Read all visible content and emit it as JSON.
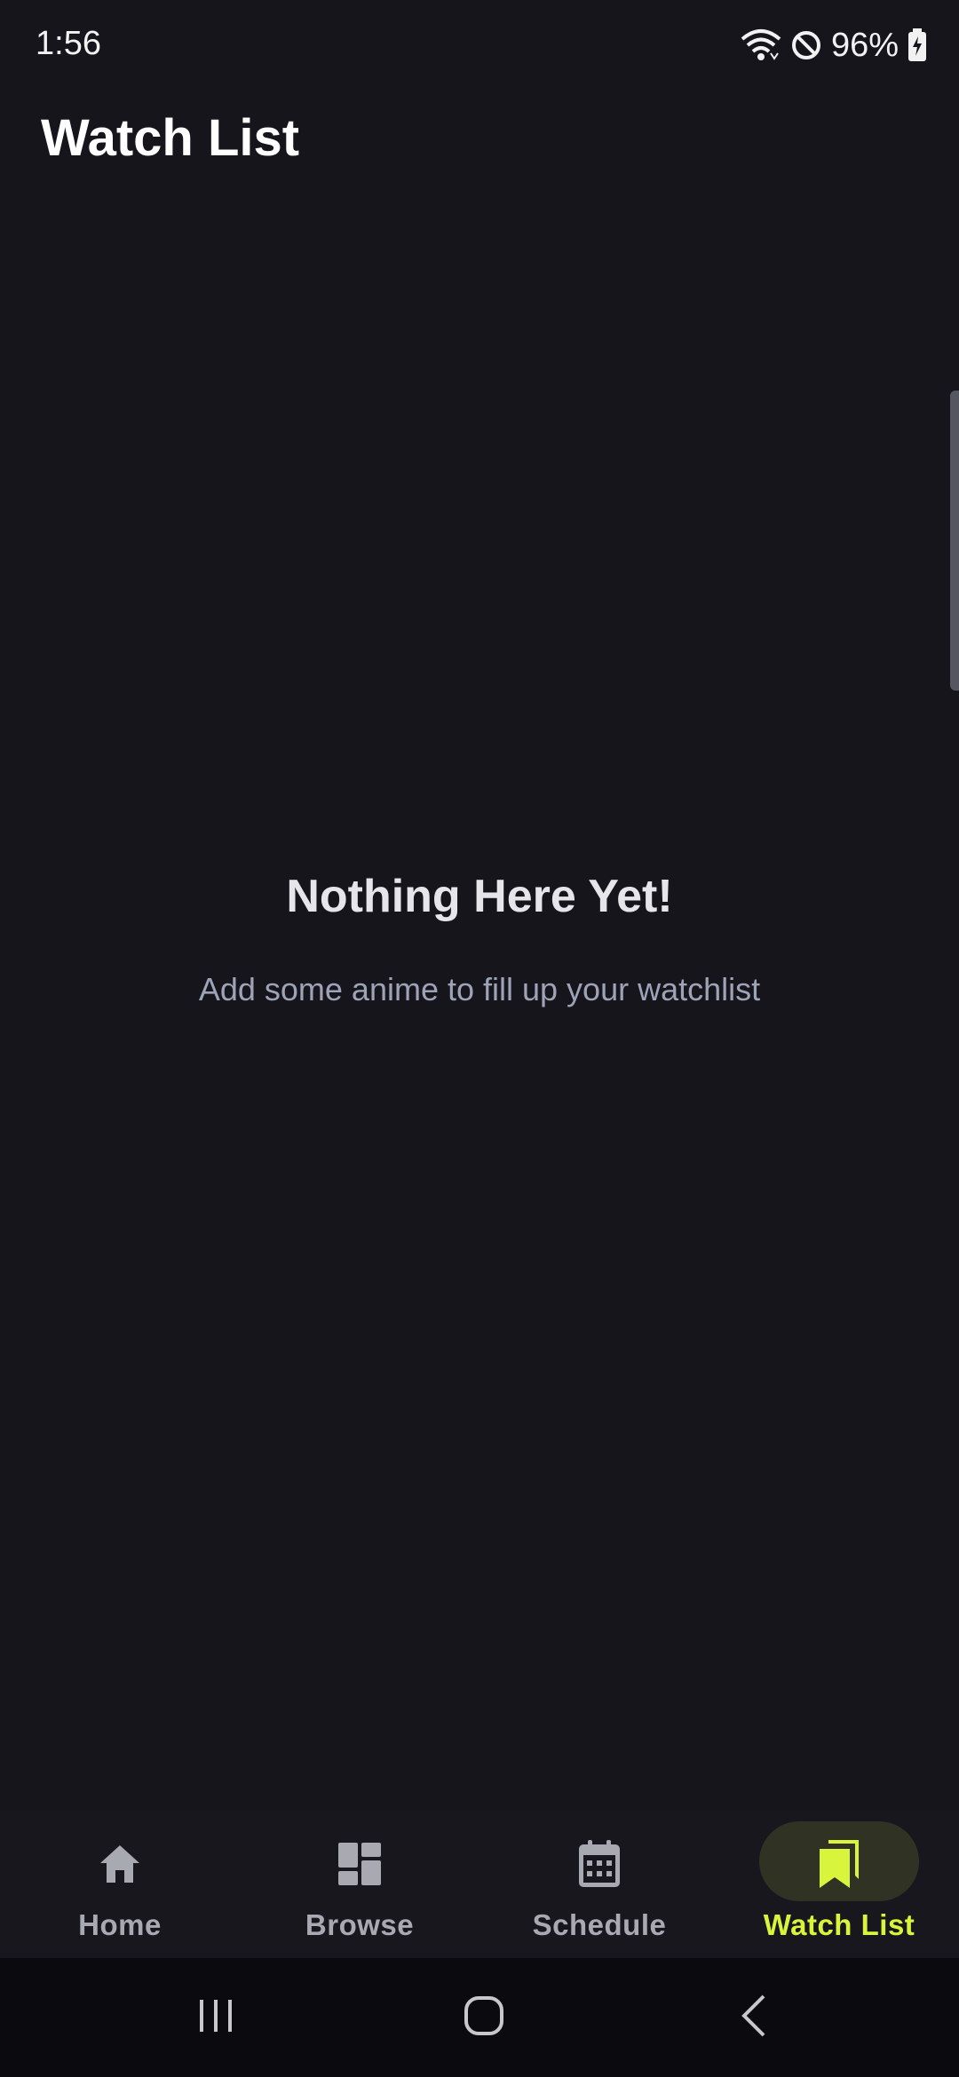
{
  "status_bar": {
    "time": "1:56",
    "battery": "96%",
    "icons": [
      "wifi-icon",
      "do-not-disturb-icon",
      "battery-charging-icon"
    ]
  },
  "header": {
    "title": "Watch List"
  },
  "empty_state": {
    "title": "Nothing Here Yet!",
    "subtitle": "Add some anime to fill up your watchlist"
  },
  "bottom_nav": {
    "items": [
      {
        "label": "Home",
        "icon": "home-icon"
      },
      {
        "label": "Browse",
        "icon": "dashboard-icon"
      },
      {
        "label": "Schedule",
        "icon": "calendar-icon"
      },
      {
        "label": "Watch List",
        "icon": "bookmarks-icon"
      }
    ],
    "active": "Watch List"
  },
  "system_nav": {
    "buttons": [
      "recent-apps-icon",
      "home-circle-icon",
      "back-icon"
    ]
  },
  "colors": {
    "background": "#15151b",
    "accent": "#d8f53c",
    "active_pill": "#303324",
    "inactive": "#a8a9b1",
    "subtitle": "#9ea3b8"
  }
}
